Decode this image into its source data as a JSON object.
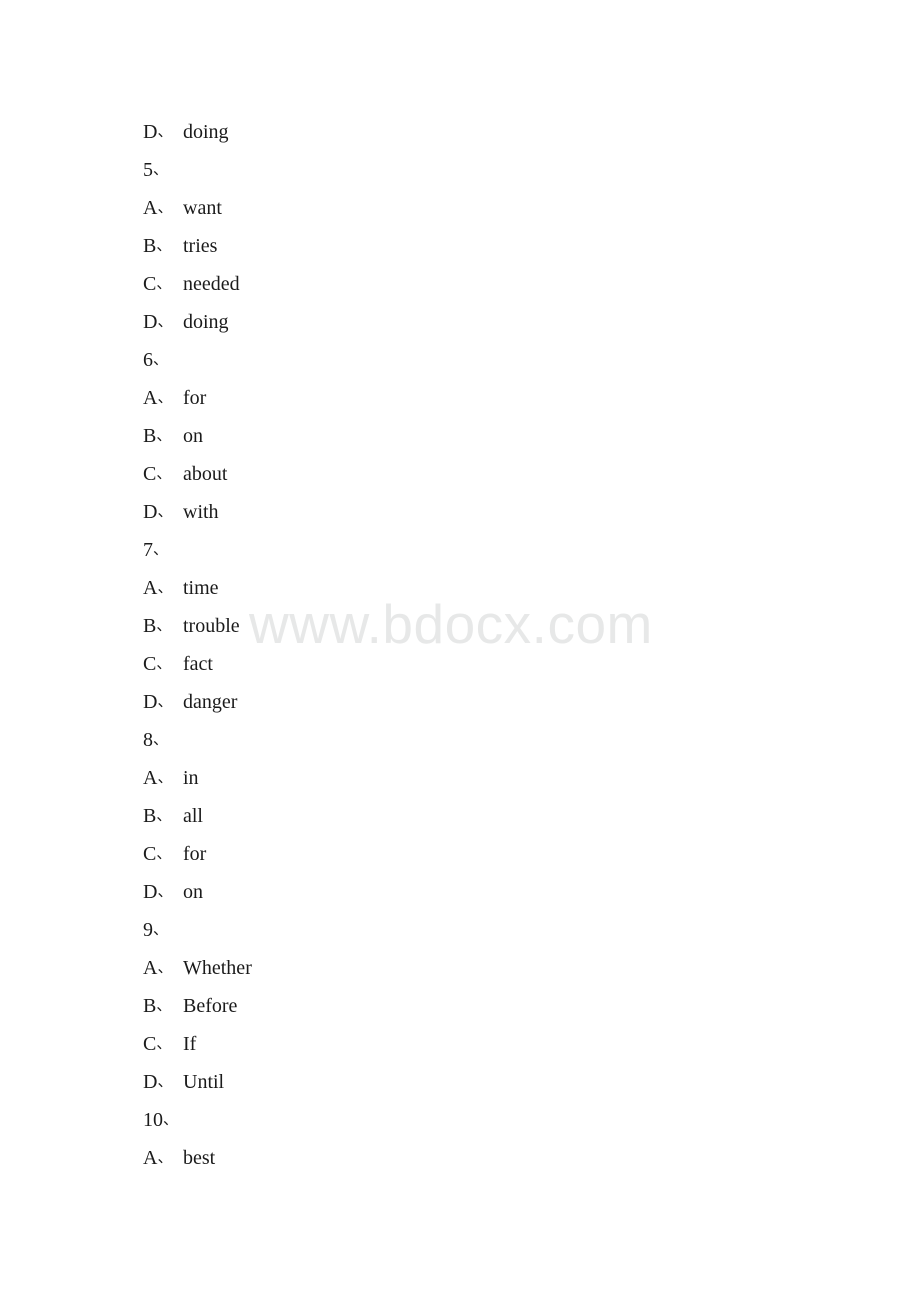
{
  "document": {
    "background_color": "#ffffff",
    "text_color": "#1b1b1b"
  },
  "watermark": {
    "text": "www.bdocx.com",
    "color": "#e7e8e8"
  },
  "separator": "、",
  "lines": [
    {
      "label": "D",
      "kind": "option",
      "text": "doing"
    },
    {
      "label": "5",
      "kind": "question",
      "text": ""
    },
    {
      "label": "A",
      "kind": "option",
      "text": "want"
    },
    {
      "label": "B",
      "kind": "option",
      "text": "tries"
    },
    {
      "label": "C",
      "kind": "option",
      "text": "needed"
    },
    {
      "label": "D",
      "kind": "option",
      "text": "doing"
    },
    {
      "label": "6",
      "kind": "question",
      "text": ""
    },
    {
      "label": "A",
      "kind": "option",
      "text": "for"
    },
    {
      "label": "B",
      "kind": "option",
      "text": "on"
    },
    {
      "label": "C",
      "kind": "option",
      "text": "about"
    },
    {
      "label": "D",
      "kind": "option",
      "text": "with"
    },
    {
      "label": "7",
      "kind": "question",
      "text": ""
    },
    {
      "label": "A",
      "kind": "option",
      "text": "time"
    },
    {
      "label": "B",
      "kind": "option",
      "text": "trouble"
    },
    {
      "label": "C",
      "kind": "option",
      "text": "fact"
    },
    {
      "label": "D",
      "kind": "option",
      "text": "danger"
    },
    {
      "label": "8",
      "kind": "question",
      "text": ""
    },
    {
      "label": "A",
      "kind": "option",
      "text": "in"
    },
    {
      "label": "B",
      "kind": "option",
      "text": "all"
    },
    {
      "label": "C",
      "kind": "option",
      "text": "for"
    },
    {
      "label": "D",
      "kind": "option",
      "text": "on"
    },
    {
      "label": "9",
      "kind": "question",
      "text": ""
    },
    {
      "label": "A",
      "kind": "option",
      "text": "Whether"
    },
    {
      "label": "B",
      "kind": "option",
      "text": "Before"
    },
    {
      "label": "C",
      "kind": "option",
      "text": "If"
    },
    {
      "label": "D",
      "kind": "option",
      "text": "Until"
    },
    {
      "label": "10",
      "kind": "question",
      "text": ""
    },
    {
      "label": "A",
      "kind": "option",
      "text": "best"
    }
  ]
}
